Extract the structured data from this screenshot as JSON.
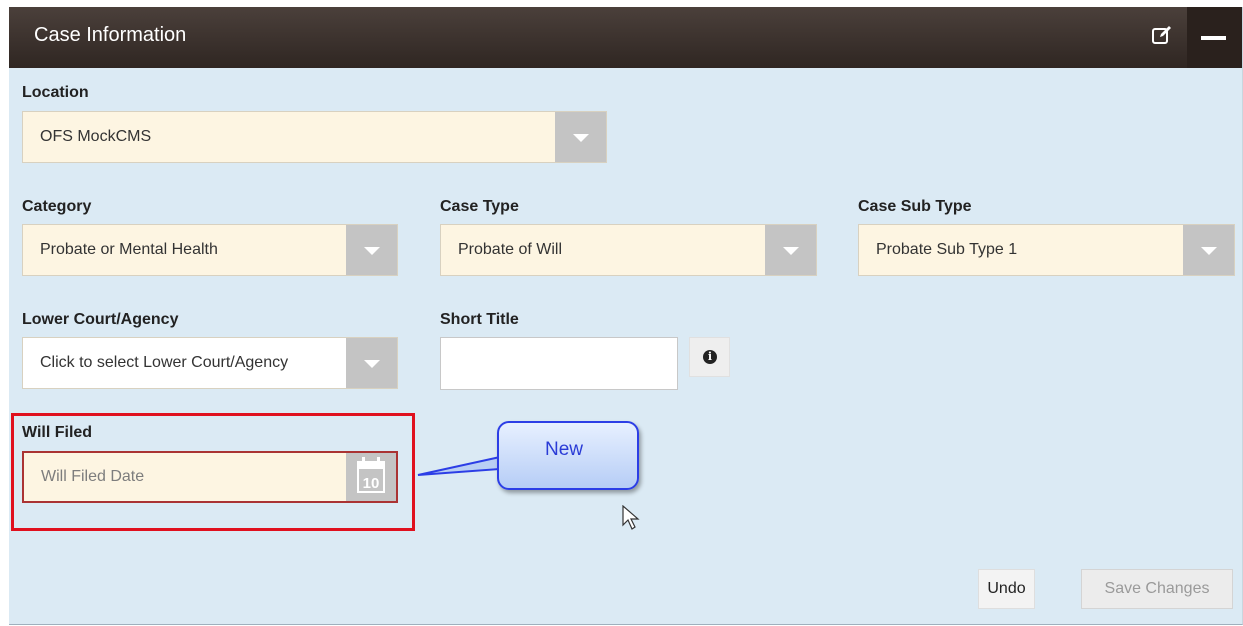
{
  "panel": {
    "title": "Case Information",
    "edit_icon": "edit-icon",
    "collapse_icon": "minus-icon"
  },
  "fields": {
    "location": {
      "label": "Location",
      "value": "OFS MockCMS"
    },
    "category": {
      "label": "Category",
      "value": "Probate or Mental Health"
    },
    "case_type": {
      "label": "Case Type",
      "value": "Probate of Will"
    },
    "case_sub_type": {
      "label": "Case Sub Type",
      "value": "Probate Sub Type 1"
    },
    "lower_court": {
      "label": "Lower Court/Agency",
      "value": "Click to select Lower Court/Agency"
    },
    "short_title": {
      "label": "Short Title",
      "value": ""
    },
    "will_filed": {
      "label": "Will Filed",
      "placeholder": "Will Filed Date",
      "calendar_day": "10"
    }
  },
  "callout": {
    "text": "New"
  },
  "buttons": {
    "undo": "Undo",
    "save": "Save Changes"
  },
  "colors": {
    "panel_bg": "#dbeaf4",
    "header_bg": "#3b302b",
    "select_bg": "#fdf5e2",
    "highlight": "#e0101e",
    "callout_border": "#2c3ee6"
  }
}
